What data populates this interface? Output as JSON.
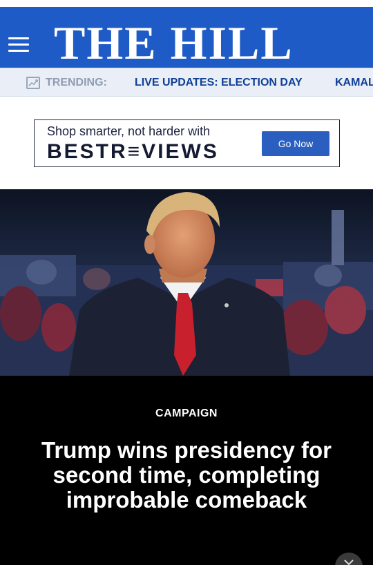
{
  "header": {
    "logo_text": "THE HILL",
    "menu_icon": "hamburger-menu-icon",
    "brand_color": "#1f5bc7"
  },
  "trending": {
    "label": "TRENDING:",
    "icon": "trending-chart-icon",
    "items": [
      "LIVE UPDATES: ELECTION DAY",
      "KAMAL"
    ]
  },
  "ad": {
    "line1": "Shop smarter, not harder with",
    "brand": "BESTR≡VIEWS",
    "button_label": "Go Now",
    "button_color": "#2a5fbf"
  },
  "hero": {
    "image": "photo-of-man-in-suit-and-red-tie-at-rally"
  },
  "story": {
    "category": "CAMPAIGN",
    "headline": "Trump wins presidency for second time, completing improbable comeback"
  },
  "overlay": {
    "close_icon": "chevron-down-icon"
  }
}
